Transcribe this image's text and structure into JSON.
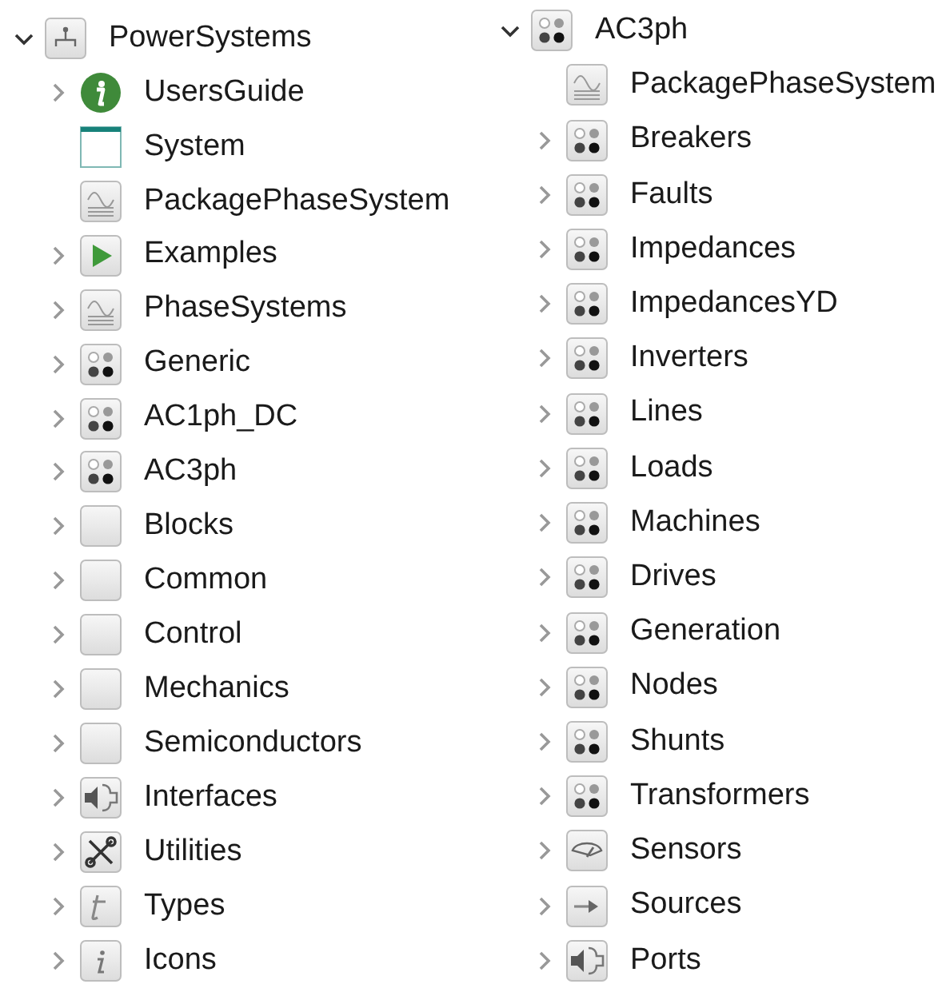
{
  "trees": [
    {
      "label": "PowerSystems",
      "kind": "hierarchy",
      "expanded": true,
      "children": [
        {
          "label": "UsersGuide",
          "kind": "info",
          "expandable": true
        },
        {
          "label": "System",
          "kind": "window",
          "expandable": false
        },
        {
          "label": "PackagePhaseSystem",
          "kind": "wave",
          "expandable": false
        },
        {
          "label": "Examples",
          "kind": "play",
          "expandable": true
        },
        {
          "label": "PhaseSystems",
          "kind": "wave",
          "expandable": true
        },
        {
          "label": "Generic",
          "kind": "dots",
          "expandable": true
        },
        {
          "label": "AC1ph_DC",
          "kind": "dots",
          "expandable": true
        },
        {
          "label": "AC3ph",
          "kind": "dots",
          "expandable": true
        },
        {
          "label": "Blocks",
          "kind": "blank",
          "expandable": true
        },
        {
          "label": "Common",
          "kind": "blank",
          "expandable": true
        },
        {
          "label": "Control",
          "kind": "blank",
          "expandable": true
        },
        {
          "label": "Mechanics",
          "kind": "blank",
          "expandable": true
        },
        {
          "label": "Semiconductors",
          "kind": "blank",
          "expandable": true
        },
        {
          "label": "Interfaces",
          "kind": "connector",
          "expandable": true
        },
        {
          "label": "Utilities",
          "kind": "tools",
          "expandable": true
        },
        {
          "label": "Types",
          "kind": "t",
          "expandable": true
        },
        {
          "label": "Icons",
          "kind": "i",
          "expandable": true
        }
      ]
    },
    {
      "label": "AC3ph",
      "kind": "dots",
      "expanded": true,
      "children": [
        {
          "label": "PackagePhaseSystem",
          "kind": "wave",
          "expandable": false
        },
        {
          "label": "Breakers",
          "kind": "dots",
          "expandable": true
        },
        {
          "label": "Faults",
          "kind": "dots",
          "expandable": true
        },
        {
          "label": "Impedances",
          "kind": "dots",
          "expandable": true
        },
        {
          "label": "ImpedancesYD",
          "kind": "dots",
          "expandable": true
        },
        {
          "label": "Inverters",
          "kind": "dots",
          "expandable": true
        },
        {
          "label": "Lines",
          "kind": "dots",
          "expandable": true
        },
        {
          "label": "Loads",
          "kind": "dots",
          "expandable": true
        },
        {
          "label": "Machines",
          "kind": "dots",
          "expandable": true
        },
        {
          "label": "Drives",
          "kind": "dots",
          "expandable": true
        },
        {
          "label": "Generation",
          "kind": "dots",
          "expandable": true
        },
        {
          "label": "Nodes",
          "kind": "dots",
          "expandable": true
        },
        {
          "label": "Shunts",
          "kind": "dots",
          "expandable": true
        },
        {
          "label": "Transformers",
          "kind": "dots",
          "expandable": true
        },
        {
          "label": "Sensors",
          "kind": "gauge",
          "expandable": true
        },
        {
          "label": "Sources",
          "kind": "arrow",
          "expandable": true
        },
        {
          "label": "Ports",
          "kind": "connector",
          "expandable": true
        }
      ]
    }
  ]
}
